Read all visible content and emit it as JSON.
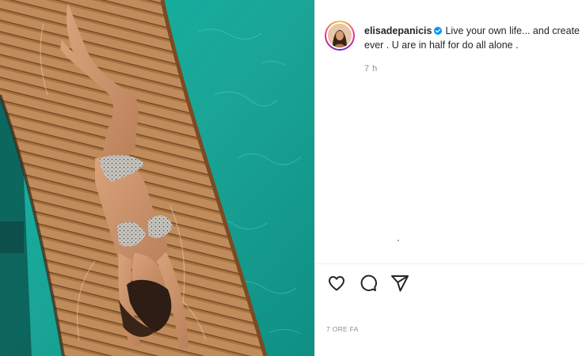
{
  "post": {
    "username": "elisadepanicis",
    "caption_line1": "Live your own life... and create",
    "caption_line2": "ever . U are in half for do all alone .",
    "relative_time": "7 h",
    "footer_date": "7 ORE FA"
  },
  "icons": {
    "verified": "verified-badge-icon",
    "like": "heart-icon",
    "comment": "comment-bubble-icon",
    "share": "paper-plane-icon"
  },
  "colors": {
    "verified_blue": "#0095f6",
    "text": "#262626",
    "muted": "#8e8e8e",
    "water": "#1fa89a",
    "deck": "#b98250"
  }
}
